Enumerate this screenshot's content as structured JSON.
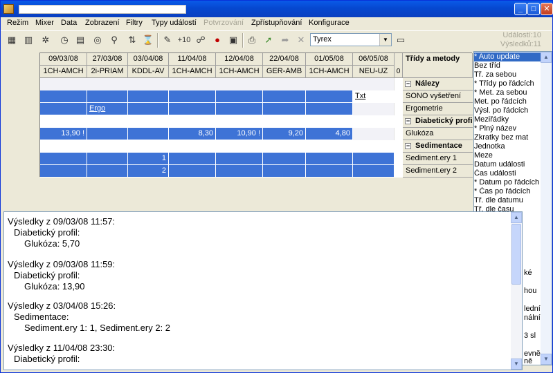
{
  "menu": {
    "items": [
      {
        "label": "Režim",
        "disabled": false
      },
      {
        "label": "Mixer",
        "disabled": false
      },
      {
        "label": "Data",
        "disabled": false
      },
      {
        "label": "Zobrazení",
        "disabled": false
      },
      {
        "label": "Filtry",
        "disabled": false
      },
      {
        "label": "Typy událostí",
        "disabled": false
      },
      {
        "label": "Potvrzování",
        "disabled": true
      },
      {
        "label": "Zpřístupňování",
        "disabled": false
      },
      {
        "label": "Konfigurace",
        "disabled": false
      }
    ]
  },
  "toolbar": {
    "plus10_label": "+10",
    "combo_value": "Tyrex",
    "stats_events": "Událostí:10",
    "stats_results": "Výsledků:11"
  },
  "grid": {
    "dates": [
      "09/03/08",
      "27/03/08",
      "03/04/08",
      "11/04/08",
      "12/04/08",
      "22/04/08",
      "01/05/08",
      "06/05/08"
    ],
    "codes": [
      "1CH-AMCH",
      "2i-PRIAM",
      "KDDL-AV",
      "1CH-AMCH",
      "1CH-AMCH",
      "GER-AMB",
      "1CH-AMCH",
      "NEU-UZ"
    ],
    "extra_col": "0",
    "header_title": "Třídy a metody",
    "categories": {
      "nalezy": "Nálezy",
      "diab": "Diabetický profil",
      "sed": "Sedimentace"
    },
    "methods": {
      "sono": "SONO vyšetření",
      "ergo": "Ergometrie",
      "gluk": "Glukóza",
      "sed1": "Sediment.ery 1",
      "sed2": "Sediment.ery 2"
    },
    "links": {
      "txt": "Txt",
      "ergo": "Ergo"
    },
    "gluk_values": [
      "13,90 !",
      "",
      "",
      "8,30",
      "10,90 !",
      "9,20",
      "4,80"
    ],
    "sed1_value": "1",
    "sed2_value": "2",
    "expand_symbol": "−"
  },
  "rlist": {
    "items": [
      {
        "label": "* Auto update",
        "selected": true
      },
      {
        "label": "  Bez tříd",
        "selected": false
      },
      {
        "label": "  Tř. za sebou",
        "selected": false
      },
      {
        "label": "* Třídy po řádcích",
        "selected": false
      },
      {
        "label": "* Met. za sebou",
        "selected": false
      },
      {
        "label": "  Met. po řádcích",
        "selected": false
      },
      {
        "label": "  Výsl. po řádcích",
        "selected": false
      },
      {
        "label": "  Meziřádky",
        "selected": false
      },
      {
        "label": "* Plný název",
        "selected": false
      },
      {
        "label": "  Zkratky bez mat",
        "selected": false
      },
      {
        "label": "  Jednotka",
        "selected": false
      },
      {
        "label": "  Meze",
        "selected": false
      },
      {
        "label": "  Datum události",
        "selected": false
      },
      {
        "label": "  Čas události",
        "selected": false
      },
      {
        "label": "* Datum po řádcích",
        "selected": false
      },
      {
        "label": "* Čas po řádcích",
        "selected": false
      },
      {
        "label": "  Tř. dle datumu",
        "selected": false
      },
      {
        "label": "  Tř. dle času",
        "selected": false
      }
    ],
    "tail": [
      "ké",
      "hou",
      "lední",
      "nální",
      "3 sl",
      "evně",
      "ně"
    ]
  },
  "results": {
    "lines": [
      "Výsledky z 09/03/08 11:57:",
      "Diabetický profil:",
      "Glukóza: 5,70",
      "",
      "Výsledky z 09/03/08 11:59:",
      "Diabetický profil:",
      "Glukóza: 13,90",
      "",
      "Výsledky z 03/04/08 15:26:",
      "Sedimentace:",
      "Sediment.ery 1: 1, Sediment.ery 2: 2",
      "",
      "Výsledky z 11/04/08 23:30:",
      "Diabetický profil:"
    ]
  },
  "icons": {
    "toolbar": [
      "grid-view-icon",
      "chart-icon",
      "hierarchy-icon",
      "clock-icon",
      "document-icon",
      "cd-icon",
      "filter-icon",
      "sort-icon",
      "hourglass-icon",
      "eraser-icon",
      "plus10-icon",
      "group-icon",
      "record-icon",
      "calendar-icon",
      "print-icon",
      "export-icon",
      "forward-icon",
      "disabled-icon",
      "window-icon"
    ]
  }
}
